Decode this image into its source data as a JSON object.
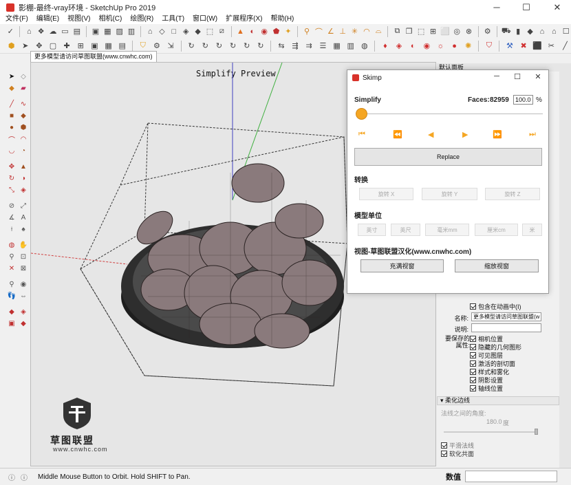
{
  "window": {
    "title": "影棚-最终-vray环境 - SketchUp Pro 2019"
  },
  "menu": [
    "文件(F)",
    "编辑(E)",
    "视图(V)",
    "相机(C)",
    "绘图(R)",
    "工具(T)",
    "窗口(W)",
    "扩展程序(X)",
    "帮助(H)"
  ],
  "scene_tab": "更多模型请访问草图联盟(www.cnwhc.com)",
  "viewport": {
    "label": "Simplify Preview"
  },
  "logo": {
    "cn": "草图联盟",
    "url": "www.cnwhc.com"
  },
  "status": {
    "hint": "Middle Mouse Button to Orbit. Hold SHIFT to Pan.",
    "measure_label": "数值"
  },
  "right_panel": {
    "header": "默认面板",
    "include_animation": "包含在动画中(I)",
    "name_label": "名称:",
    "name_value": "更多模型请访问草图联盟(w",
    "desc_label": "说明:",
    "props_label_1": "要保存的",
    "props_label_2": "属性:",
    "props": [
      "相机位置",
      "隐藏的几何图形",
      "可见图层",
      "激活的剖切面",
      "样式和雾化",
      "阴影设置",
      "轴线位置"
    ],
    "soften_header": "柔化边线",
    "angle_label": "法线之间的角度:",
    "angle_value": "180.0",
    "angle_unit": "度",
    "smooth_normals": "平滑法线",
    "soften_coplanar": "软化共面"
  },
  "dialog": {
    "title": "Skimp",
    "simplify_label": "Simplify",
    "faces_label": "Faces:",
    "faces_value": "82959",
    "percent_value": "100.0",
    "percent_unit": "%",
    "slider_percent": 0,
    "replace_label": "Replace",
    "transform_label": "转换",
    "rotate_buttons": [
      "旋转 X",
      "旋转 Y",
      "旋转 Z"
    ],
    "units_label": "模型单位",
    "unit_buttons": [
      "英寸",
      "英尺",
      "毫米mm",
      "厘米cm",
      "米"
    ],
    "view_label": "视图-草图联盟汉化(www.cnwhc.com)",
    "fill_view": "充满视窗",
    "zoom_view": "缩放视窗"
  },
  "colors": {
    "accent": "#f5a623",
    "fruit": "#8a7a7c",
    "bowl": "#2a2a2a"
  }
}
